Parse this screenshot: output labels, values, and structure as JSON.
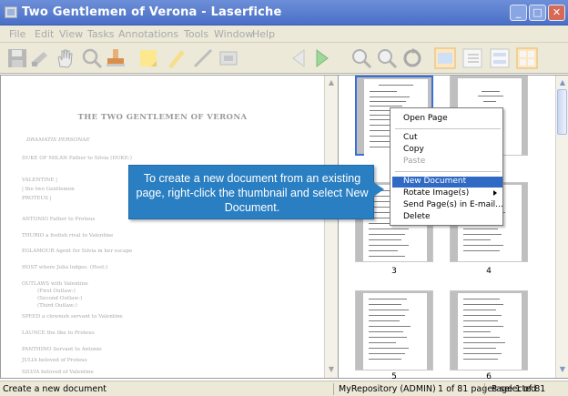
{
  "window": {
    "title": "Two Gentlemen of Verona - Laserfiche",
    "minimize": "_",
    "maximize": "□",
    "close": "✕"
  },
  "menu": [
    "File",
    "Edit",
    "View",
    "Tasks",
    "Annotations",
    "Tools",
    "Window",
    "Help"
  ],
  "toolbar": {
    "icons": [
      "save-icon",
      "scan-icon",
      "pan-hand-icon",
      "search-icon",
      "stamp-icon",
      "sticky-note-icon",
      "highlighter-icon",
      "line-draw-icon",
      "redaction-icon",
      "previous-page-icon",
      "next-page-icon",
      "zoom-in-icon",
      "zoom-out-icon",
      "rotate-icon",
      "thumbnails-view-icon",
      "text-view-icon",
      "fields-view-icon",
      "grid-view-icon"
    ]
  },
  "document": {
    "title": "THE TWO GENTLEMEN OF VERONA",
    "lines": [
      "DRAMATIS PERSONAE",
      "DUKE OF MILAN   Father to Silvia (DUKE:)",
      "VALENTINE   |",
      "              | the two Gentlemen",
      "PROTEUS     |",
      "ANTONIO   Father to Proteus",
      "THURIO   a foolish rival to Valentine",
      "EGLAMOUR   Agent for Silvia in her escape",
      "HOST   where Julia lodges. (Host:)",
      "OUTLAWS   with Valentine",
      "(First Outlaw:)",
      "(Second Outlaw:)",
      "(Third Outlaw:)",
      "SPEED   a clownish servant to Valentine",
      "LAUNCE   the like to Proteus",
      "PANTHINO   Servant to Antonio",
      "JULIA   beloved of Proteus",
      "SILVIA   beloved of Valentine"
    ]
  },
  "thumbnails": {
    "labels": [
      "",
      "",
      "3",
      "4",
      "5",
      "6"
    ]
  },
  "context_menu": {
    "items": [
      "Open Page",
      "Cut",
      "Copy",
      "Paste",
      "New Document",
      "Rotate Image(s)",
      "Send Page(s) in E-mail...",
      "Delete"
    ],
    "highlighted": "New Document",
    "disabled": [
      "Paste"
    ]
  },
  "callout": {
    "text": "To create a new document from an existing page, right-click the thumbnail and select New Document."
  },
  "status": {
    "left": "Create a new document",
    "repository": "MyRepository (ADMIN)",
    "selection": "1 of 81 pages selected",
    "page": "Page 1 of 81"
  },
  "colors": {
    "titlebar": "#4a6fc7",
    "highlight": "#316ac5",
    "callout": "#2a7fc2",
    "chrome": "#ece9d8"
  }
}
